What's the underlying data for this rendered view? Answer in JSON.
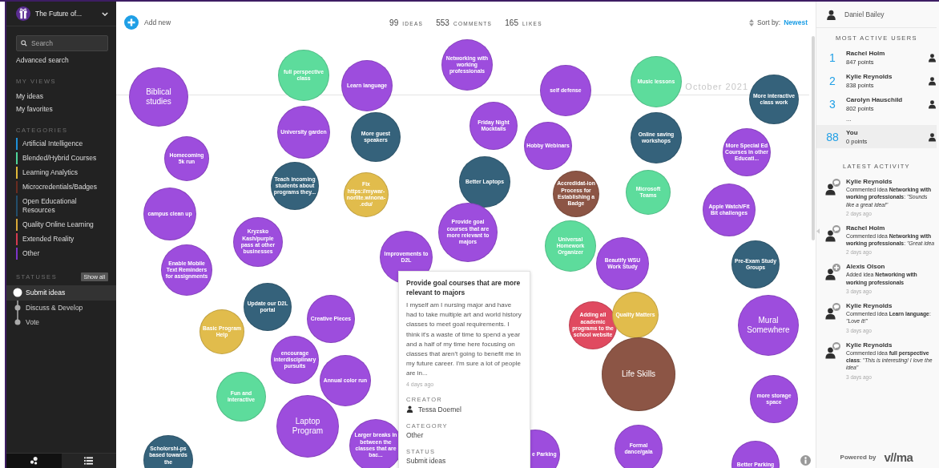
{
  "workspace": {
    "title": "The Future of..."
  },
  "search": {
    "placeholder": "Search"
  },
  "advanced_search": "Advanced search",
  "my_views": {
    "heading": "MY VIEWS",
    "items": [
      "My ideas",
      "My favorites"
    ]
  },
  "categories": {
    "heading": "CATEGORIES",
    "items": [
      {
        "label": "Artificial Intelligence",
        "color": "#1e90d8"
      },
      {
        "label": "Blended/Hybrid Courses",
        "color": "#4fd49a"
      },
      {
        "label": "Learning Analytics",
        "color": "#e0b83a"
      },
      {
        "label": "Microcredentials/Badges",
        "color": "#6a2c20"
      },
      {
        "label": "Open Educational Resources",
        "color": "#234e6b"
      },
      {
        "label": "Quality Online Learning",
        "color": "#d9a838"
      },
      {
        "label": "Extended Reality",
        "color": "#d43a50"
      },
      {
        "label": "Other",
        "color": "#7d34c8"
      }
    ]
  },
  "statuses": {
    "heading": "STATUSES",
    "show_all": "Show all",
    "items": [
      {
        "label": "Submit ideas",
        "selected": true
      },
      {
        "label": "Discuss & Develop",
        "selected": false
      },
      {
        "label": "Vote",
        "selected": false
      }
    ]
  },
  "view_tabs": [
    {
      "kind": "bubbles",
      "selected": true
    },
    {
      "kind": "list",
      "selected": false
    }
  ],
  "toolbar": {
    "add_new": "Add new",
    "stats": [
      {
        "value": "99",
        "label": "IDEAS"
      },
      {
        "value": "553",
        "label": "COMMENTS"
      },
      {
        "value": "165",
        "label": "LIKES"
      }
    ],
    "sort_label": "Sort by:",
    "sort_value": "Newest"
  },
  "timeline_label": "October 2021",
  "bubbles": [
    {
      "label": "Biblical studies",
      "color": "#9d4ddd"
    },
    {
      "label": "full perspective class",
      "color": "#5ddc9c"
    },
    {
      "label": "Learn language",
      "color": "#9d4ddd"
    },
    {
      "label": "Networking with working professionals",
      "color": "#9d4ddd"
    },
    {
      "label": "self defense",
      "color": "#9d4ddd"
    },
    {
      "label": "Music lessons",
      "color": "#5ddc9c"
    },
    {
      "label": "More interactive class work",
      "color": "#35627b"
    },
    {
      "label": "Homecoming 5k run",
      "color": "#9d4ddd"
    },
    {
      "label": "University garden",
      "color": "#9d4ddd"
    },
    {
      "label": "More guest speakers",
      "color": "#35627b"
    },
    {
      "label": "Friday Night Mocktails",
      "color": "#9d4ddd"
    },
    {
      "label": "Hobby Webinars",
      "color": "#9d4ddd"
    },
    {
      "label": "Online saving workshops",
      "color": "#35627b"
    },
    {
      "label": "More Special Ed Courses in other Educati...",
      "color": "#9d4ddd"
    },
    {
      "label": "campus clean up",
      "color": "#9d4ddd"
    },
    {
      "label": "Teach incoming students about programs they...",
      "color": "#35627b"
    },
    {
      "label": "Fix https://mywar-norlite.winona-.edu/",
      "color": "#e1bc4c"
    },
    {
      "label": "Better Laptops",
      "color": "#35627b"
    },
    {
      "label": "Accredidat-ion Process for Establishing a Badge",
      "color": "#8c5545"
    },
    {
      "label": "Microsoft Teams",
      "color": "#5ddc9c"
    },
    {
      "label": "Apple Watch/Fit Bit challenges",
      "color": "#9d4ddd"
    },
    {
      "label": "Enable Mobile Text Reminders for assignments",
      "color": "#9d4ddd"
    },
    {
      "label": "Kryzsko Kash/purple pass at other businesses",
      "color": "#9d4ddd"
    },
    {
      "label": "Improvements to D2L",
      "color": "#9d4ddd"
    },
    {
      "label": "Provide goal courses that are more relevant to majors",
      "color": "#9d4ddd"
    },
    {
      "label": "Universal Homework Organizer",
      "color": "#5ddc9c"
    },
    {
      "label": "Beautify WSU Work Study",
      "color": "#9d4ddd"
    },
    {
      "label": "Pre-Exam Study Groups",
      "color": "#35627b"
    },
    {
      "label": "Basic Program Help",
      "color": "#e1bc4c"
    },
    {
      "label": "Update our D2L portal",
      "color": "#35627b"
    },
    {
      "label": "Creative Pieces",
      "color": "#9d4ddd"
    },
    {
      "label": "Adding all academic programs to the school website",
      "color": "#e04a60"
    },
    {
      "label": "Quality Matters",
      "color": "#e1bc4c"
    },
    {
      "label": "Mural Somewhere",
      "color": "#9d4ddd"
    },
    {
      "label": "Fun and Interactive",
      "color": "#5ddc9c"
    },
    {
      "label": "encourage interdisciplinary pursuits",
      "color": "#9d4ddd"
    },
    {
      "label": "Annual color run",
      "color": "#9d4ddd"
    },
    {
      "label": "Life Skills",
      "color": "#8c5545"
    },
    {
      "label": "more storage space",
      "color": "#9d4ddd"
    },
    {
      "label": "Scholorshi-ps based towards the",
      "color": "#35627b"
    },
    {
      "label": "Laptop Program",
      "color": "#9d4ddd"
    },
    {
      "label": "Larger breaks in between the classes that are bac...",
      "color": "#9d4ddd"
    },
    {
      "label": "e Parking",
      "color": "#9d4ddd"
    },
    {
      "label": "Formal dance/gala",
      "color": "#9d4ddd"
    },
    {
      "label": "Better Parking",
      "color": "#9d4ddd"
    }
  ],
  "popup": {
    "title": "Provide goal courses that are more relevant to majors",
    "body": "I myself am I nursing major and have had to take multiple art and world history classes to meet goal requirements. I think it's a waste of time to spend a year and a half of my time here focusing on classes that aren't going to benefit me in my future career. I'm sure a lot of people are in...",
    "time": "4 days ago",
    "creator_heading": "CREATOR",
    "creator": "Tessa Doemel",
    "category_heading": "CATEGORY",
    "category": "Other",
    "status_heading": "STATUS",
    "status": "Submit ideas"
  },
  "user": {
    "name": "Daniel Bailey"
  },
  "most_active": {
    "heading": "MOST ACTIVE USERS",
    "users": [
      {
        "rank": "1",
        "name": "Rachel Holm",
        "points": "847 points"
      },
      {
        "rank": "2",
        "name": "Kylie Reynolds",
        "points": "838 points"
      },
      {
        "rank": "3",
        "name": "Carolyn Hauschild",
        "points": "802 points"
      }
    ],
    "ellipsis": "...",
    "you": {
      "rank": "88",
      "name": "You",
      "points": "0 points"
    }
  },
  "latest_activity": {
    "heading": "LATEST ACTIVITY",
    "items": [
      {
        "user": "Kylie Reynolds",
        "kind": "comment",
        "text": "Commented idea **Networking with working professionals**: *\"Sounds like a great idea!\"*",
        "time": "2 days ago"
      },
      {
        "user": "Rachel Holm",
        "kind": "comment",
        "text": "Commented idea **Networking with working professionals**: *\"Great idea*",
        "time": "2 days ago"
      },
      {
        "user": "Alexis Olson",
        "kind": "add",
        "text": "Added idea **Networking with working professionals**",
        "time": "3 days ago"
      },
      {
        "user": "Kylie Reynolds",
        "kind": "comment",
        "text": "Commented idea **Learn language**: *\"Love it!\"*",
        "time": "3 days ago"
      },
      {
        "user": "Kylie Reynolds",
        "kind": "comment",
        "text": "Commented idea **full perspective class**: *\"This is interesting! I love the idea\"*",
        "time": "3 days ago"
      }
    ]
  },
  "footer": {
    "powered_by": "Powered by",
    "logo": "v//ma"
  }
}
